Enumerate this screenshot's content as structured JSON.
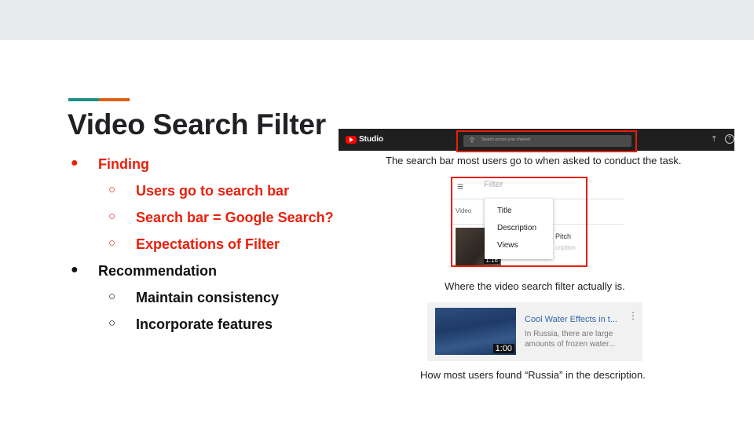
{
  "slide": {
    "title": "Video Search Filter",
    "accent_colors": [
      "#1e9185",
      "#e0600e"
    ]
  },
  "bullets": [
    {
      "level": 1,
      "marker": "●",
      "text": "Finding",
      "color": "#e8200c"
    },
    {
      "level": 2,
      "marker": "○",
      "text": "Users go to search bar",
      "color": "#e8200c"
    },
    {
      "level": 2,
      "marker": "○",
      "text": "Search bar = Google Search?",
      "color": "#e8200c"
    },
    {
      "level": 2,
      "marker": "○",
      "text": "Expectations of Filter",
      "color": "#e8200c"
    },
    {
      "level": 1,
      "marker": "●",
      "text": "Recommendation",
      "color": "#111111"
    },
    {
      "level": 2,
      "marker": "○",
      "text": "Maintain consistency",
      "color": "#111111"
    },
    {
      "level": 2,
      "marker": "○",
      "text": "Incorporate features",
      "color": "#111111"
    }
  ],
  "studio_bar": {
    "logo_text": "Studio",
    "search_placeholder": "Search across your channel",
    "search_icon": "magnifier-icon",
    "upload_icon": "upload-icon",
    "help_icon": "help-icon",
    "help_glyph": "?"
  },
  "captions": {
    "search": "The search bar most users go to when asked to conduct the task.",
    "filter": "Where the video search filter actually is.",
    "found": "How most users found “Russia” in the description."
  },
  "filter_panel": {
    "placeholder": "Filter",
    "column_header": "Video",
    "menu_items": [
      "Title",
      "Description",
      "Views"
    ],
    "video_duration": "1:16",
    "video_title_fragment": "Pitch",
    "video_desc_fragment": "cription"
  },
  "video_card": {
    "title": "Cool Water Effects in t...",
    "description": "In Russia, there are large amounts of frozen water...",
    "duration": "1:00",
    "more_icon": "more-vert-icon"
  },
  "highlight_color": "#e8200c"
}
